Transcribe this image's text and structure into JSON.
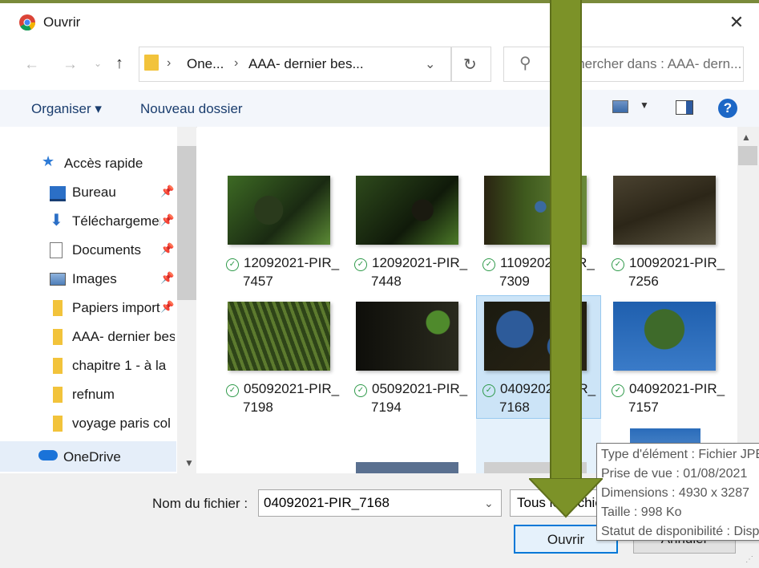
{
  "window": {
    "title": "Ouvrir"
  },
  "address": {
    "crumbs": [
      "One...",
      "AAA- dernier bes..."
    ],
    "search_placeholder": "Rechercher dans : AAA- dern..."
  },
  "toolbar": {
    "organize": "Organiser ▾",
    "new_folder": "Nouveau dossier",
    "help": "?"
  },
  "sidebar": {
    "quick_access": "Accès rapide",
    "items": [
      {
        "label": "Bureau",
        "pinned": true
      },
      {
        "label": "Téléchargements",
        "pinned": true
      },
      {
        "label": "Documents",
        "pinned": true
      },
      {
        "label": "Images",
        "pinned": true
      },
      {
        "label": "Papiers importants",
        "pinned": true
      },
      {
        "label": "AAA- dernier besoin",
        "pinned": false
      },
      {
        "label": "chapitre 1 - à la",
        "pinned": false
      },
      {
        "label": "refnum",
        "pinned": false
      },
      {
        "label": "voyage paris col",
        "pinned": false
      }
    ],
    "onedrive": "OneDrive"
  },
  "files": [
    {
      "line1": "12092021-PIR_",
      "line2": "7457"
    },
    {
      "line1": "12092021-PIR_",
      "line2": "7448"
    },
    {
      "line1": "11092021-PIR_",
      "line2": "7309"
    },
    {
      "line1": "10092021-PIR_",
      "line2": "7256"
    },
    {
      "line1": "05092021-PIR_",
      "line2": "7198"
    },
    {
      "line1": "05092021-PIR_",
      "line2": "7194"
    },
    {
      "line1": "04092021-PIR_",
      "line2": "7168"
    },
    {
      "line1": "04092021-PIR_",
      "line2": "7157"
    }
  ],
  "bottom": {
    "filename_label": "Nom du fichier :",
    "filename_value": "04092021-PIR_7168",
    "filetype": "Tous les fichiers",
    "open": "Ouvrir",
    "cancel": "Annuler"
  },
  "tooltip": {
    "type": "Type d'élément : Fichier JPEG",
    "taken": "Prise de vue : 01/08/2021",
    "dimensions": "Dimensions : 4930 x 3287",
    "size": "Taille : 998 Ko",
    "status": "Statut de disponibilité : Disponible"
  },
  "colors": {
    "arrow": "#7c9228",
    "accent": "#0078d7",
    "selection": "#cce4f7"
  }
}
